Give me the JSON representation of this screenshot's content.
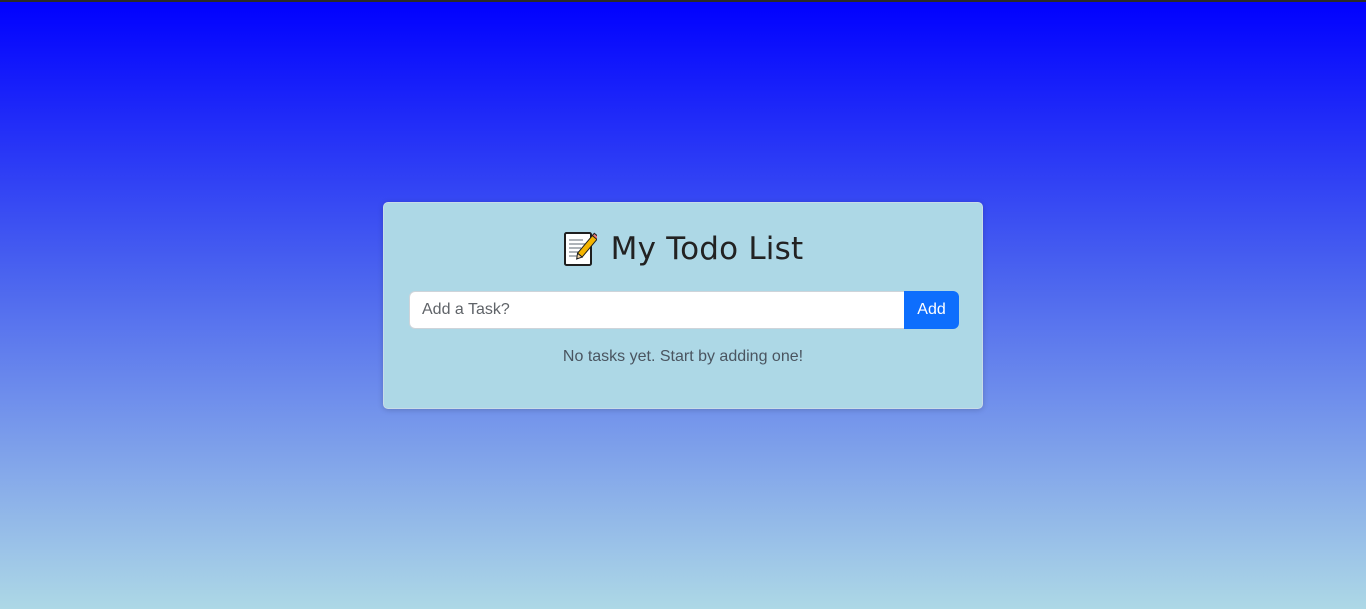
{
  "app": {
    "title": "My Todo List",
    "title_icon": "memo-icon"
  },
  "form": {
    "input_placeholder": "Add a Task?",
    "input_value": "",
    "add_label": "Add"
  },
  "list": {
    "empty_message": "No tasks yet. Start by adding one!",
    "items": []
  },
  "colors": {
    "background_top": "#0000ff",
    "background_bottom": "#add8e6",
    "card": "#add8e6",
    "primary_button": "#0d6efd"
  }
}
